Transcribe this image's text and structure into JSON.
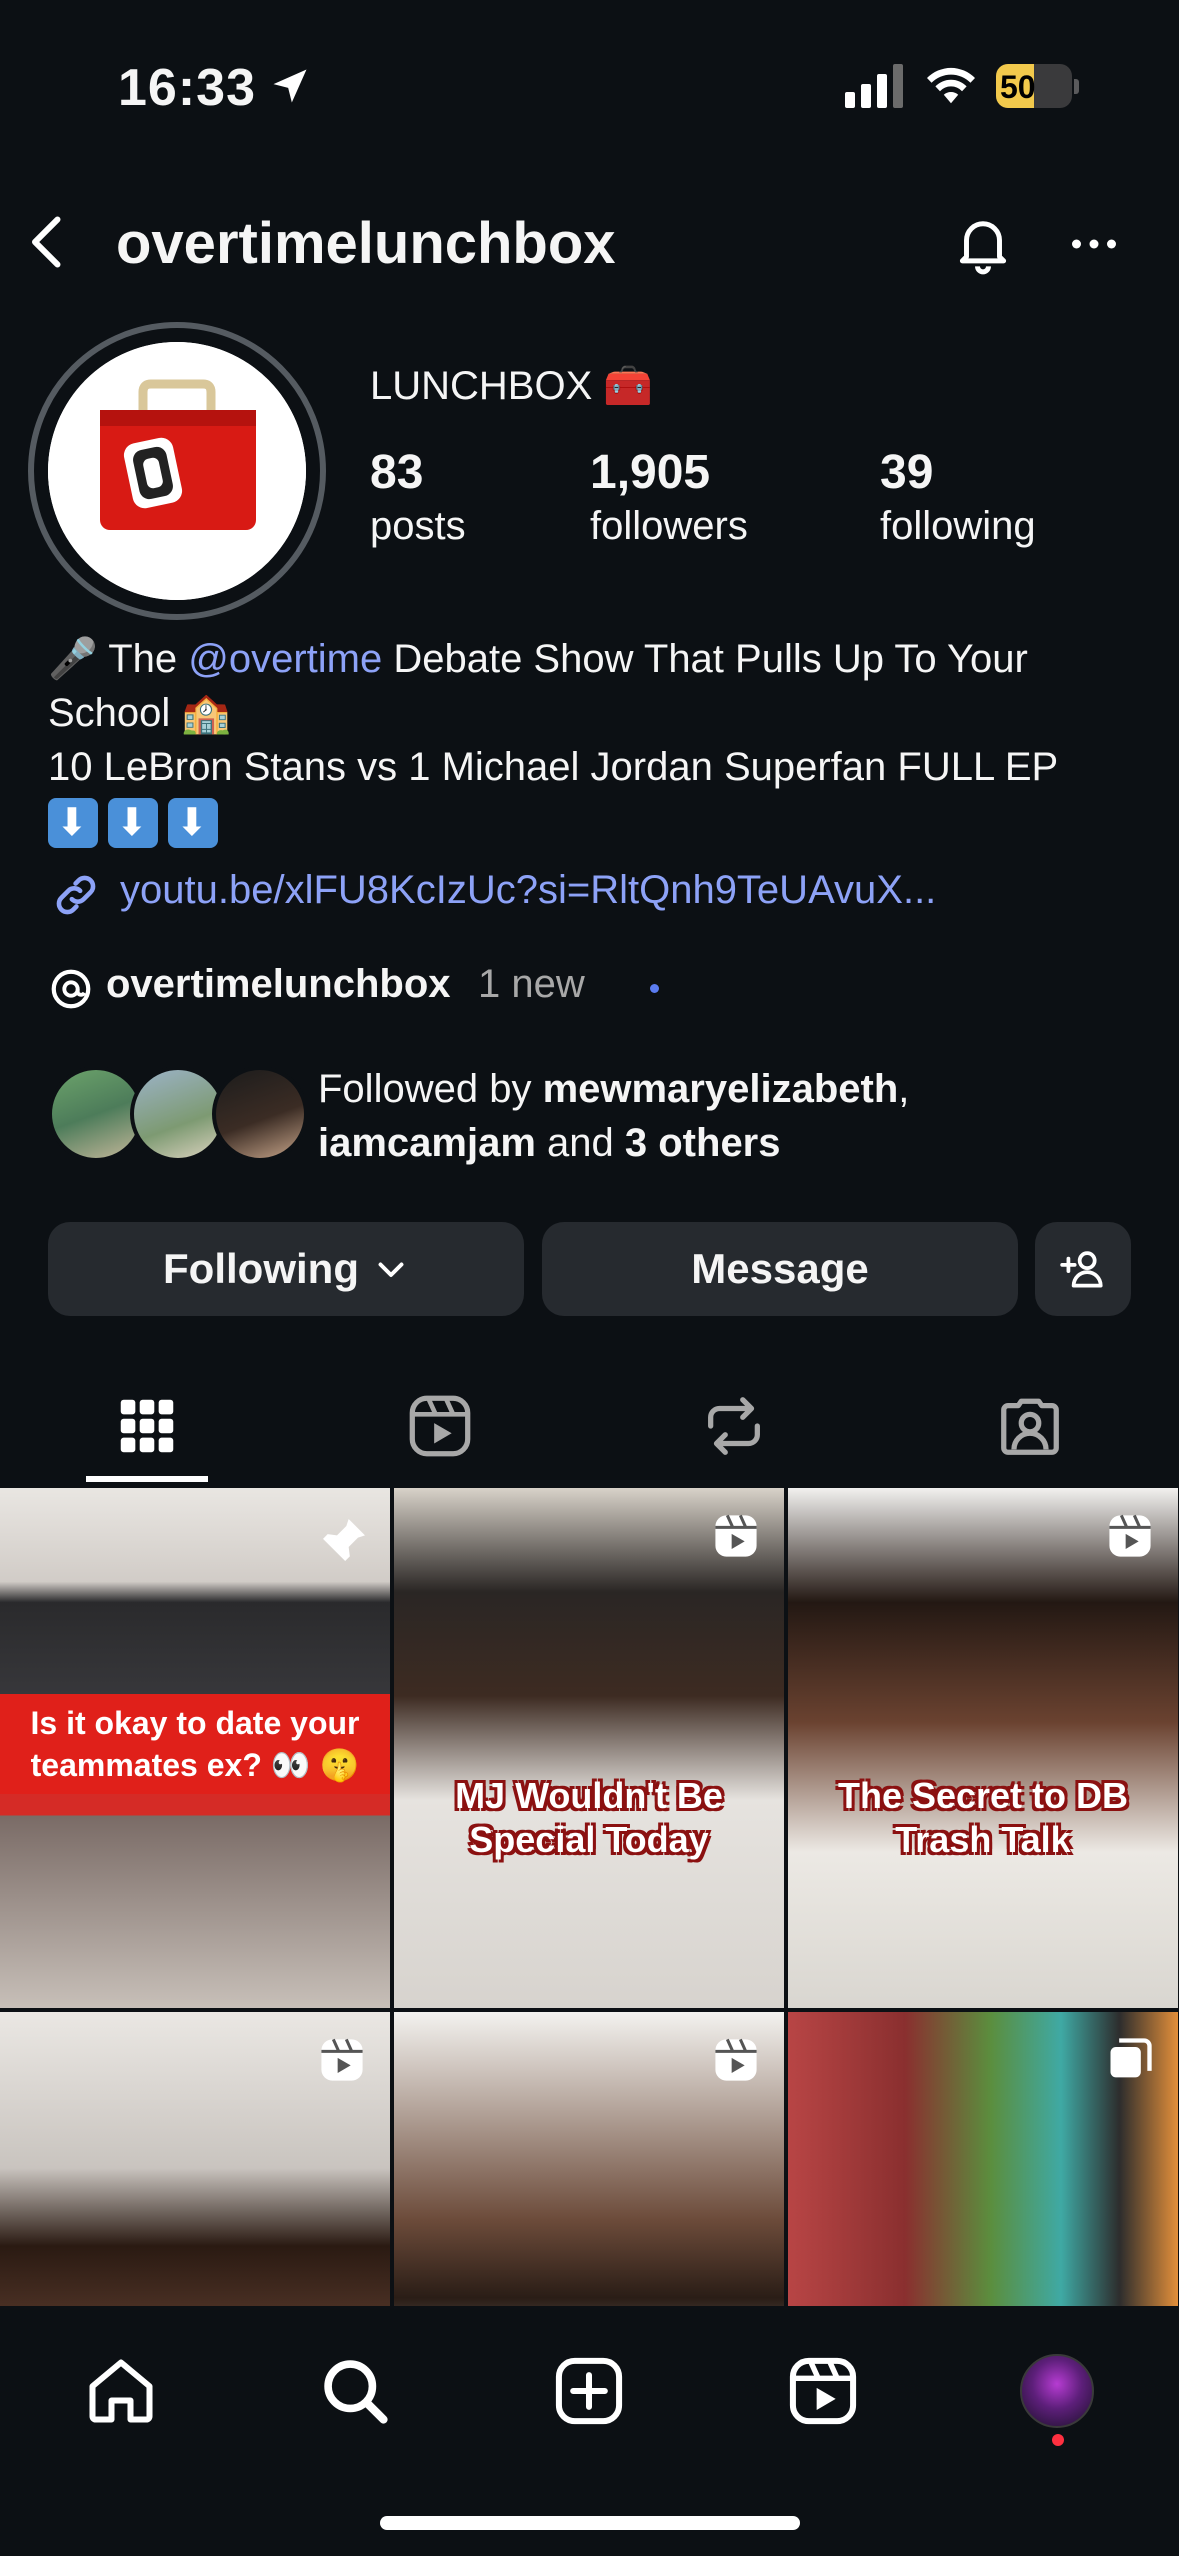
{
  "status_bar": {
    "time": "16:33",
    "battery": "50",
    "battery_level": 0.5
  },
  "header": {
    "username": "overtimelunchbox"
  },
  "profile": {
    "display_name": "LUNCHBOX 🧰",
    "stats": [
      {
        "value": "83",
        "label": "posts"
      },
      {
        "value": "1,905",
        "label": "followers"
      },
      {
        "value": "39",
        "label": "following"
      }
    ],
    "bio": {
      "line1_prefix": "🎤 The ",
      "mention": "@overtime",
      "line1_suffix": " Debate Show That Pulls Up To Your School 🏫",
      "line2": "10 LeBron Stans vs 1 Michael Jordan Superfan FULL EP"
    },
    "link": "youtu.be/xlFU8KcIzUc?si=RltQnh9TeUAvuX...",
    "threads": {
      "name": "overtimelunchbox",
      "new": "1 new"
    },
    "followed_by": {
      "prefix": "Followed by ",
      "user1": "mewmaryelizabeth",
      "sep": ",",
      "user2": "iamcamjam",
      "and": " and ",
      "others": "3 others"
    }
  },
  "actions": {
    "following": "Following",
    "message": "Message"
  },
  "posts": [
    {
      "caption": "Is it okay to date your teammates ex? 👀 🤫",
      "pinned": true
    },
    {
      "caption": "MJ Wouldn't Be Special Today",
      "type": "reel"
    },
    {
      "caption": "The Secret to DB Trash Talk",
      "type": "reel"
    },
    {
      "caption": "",
      "type": "reel"
    },
    {
      "caption": "",
      "type": "reel"
    },
    {
      "caption": "",
      "type": "carousel"
    }
  ],
  "colors": {
    "background": "#0c1014",
    "button": "#262a2f",
    "link": "#8da2f7",
    "accent_red": "#e0201a",
    "notification_dot": "#ff3040"
  }
}
